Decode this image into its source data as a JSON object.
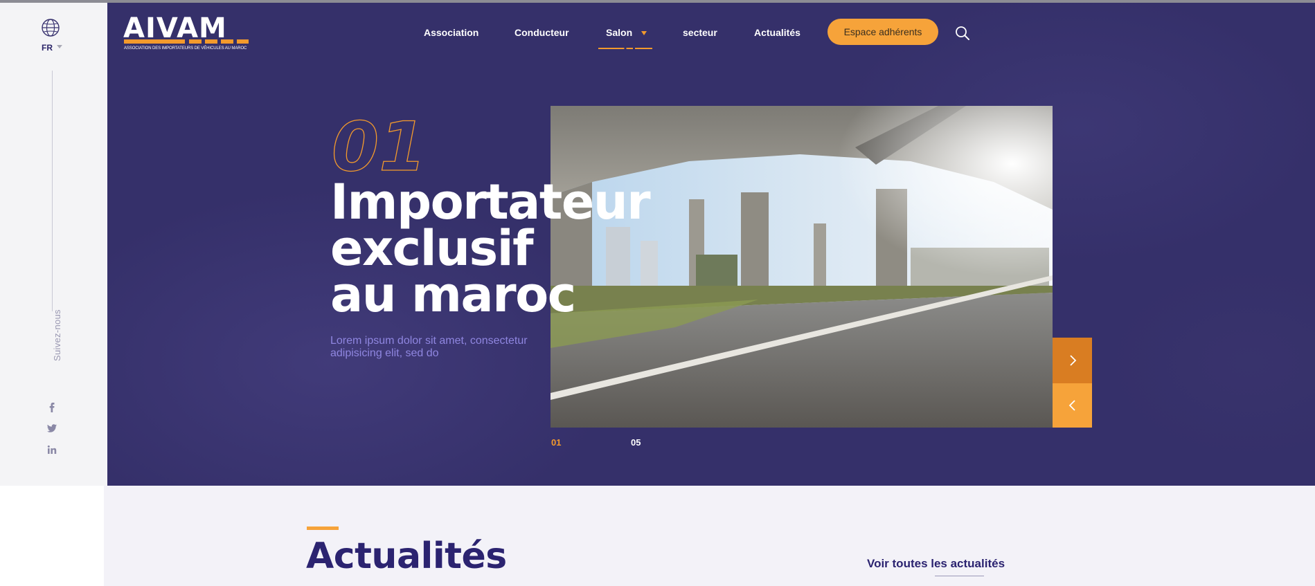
{
  "language": {
    "current": "FR"
  },
  "follow_label": "Suivez-nous",
  "social": [
    "facebook-icon",
    "twitter-icon",
    "linkedin-icon"
  ],
  "logo": {
    "name": "AIVAM",
    "tagline": "ASSOCIATION DES IMPORTATEURS DE VÉHICULES AU MAROC"
  },
  "nav": {
    "items": [
      {
        "label": "Association"
      },
      {
        "label": "Conducteur"
      },
      {
        "label": "Salon",
        "active": true,
        "has_dropdown": true
      },
      {
        "label": "secteur"
      },
      {
        "label": "Actualités"
      }
    ],
    "cta_label": "Espace adhérents"
  },
  "hero": {
    "slide_number": "01",
    "title_lines": [
      "Importateur",
      "exclusif",
      "au maroc"
    ],
    "description": "Lorem ipsum dolor sit amet, consectetur adipisicing elit, sed do",
    "current_slide": "01",
    "total_slides": "05"
  },
  "news": {
    "title": "Actualités",
    "see_all_label": "Voir toutes les actualités"
  },
  "colors": {
    "accent": "#f6a33a",
    "accent_dark": "#d97d22",
    "primary": "#35306a",
    "heading": "#2b2370"
  }
}
